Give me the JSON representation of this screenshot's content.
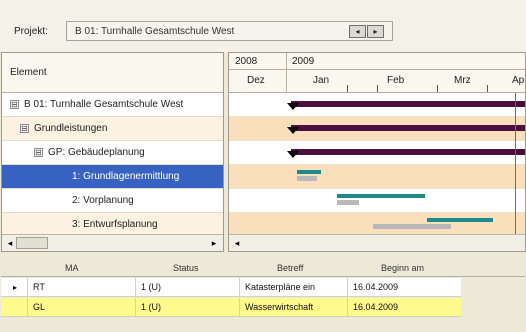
{
  "project": {
    "label": "Projekt:",
    "value": "B 01: Turnhalle Gesamtschule West",
    "btn_prev": "◂",
    "btn_next": "▸"
  },
  "tree": {
    "header": "Element",
    "items": [
      {
        "label": "B 01: Turnhalle Gesamtschule West",
        "exp": "⊟"
      },
      {
        "label": "Grundleistungen",
        "exp": "⊟"
      },
      {
        "label": "GP: Gebäudeplanung",
        "exp": "⊟"
      },
      {
        "label": "1: Grundlagenermittlung",
        "exp": ""
      },
      {
        "label": "2: Vorplanung",
        "exp": ""
      },
      {
        "label": "3: Entwurfsplanung",
        "exp": ""
      }
    ],
    "scroll_left": "◂",
    "scroll_right": "▸"
  },
  "gantt": {
    "years": [
      "2008",
      "2009"
    ],
    "months": [
      "Dez",
      "Jan",
      "Feb",
      "Mrz",
      "Apr"
    ],
    "scroll_left": "◂",
    "colors": {
      "summary": "#4a0f3c",
      "task": "#1f8a8a",
      "baseline": "#b8b8b8",
      "today": "#d24a2a",
      "row_alt": "#f9dfbc"
    }
  },
  "table": {
    "headers": [
      "MA",
      "Status",
      "Betreff",
      "Beginn am"
    ],
    "pointer": "▸",
    "rows": [
      {
        "ma": "RT",
        "status": "1 (U)",
        "betreff": "Katasterpläne ein",
        "beginn": "16.04.2009"
      },
      {
        "ma": "GL",
        "status": "1 (U)",
        "betreff": "Wasserwirtschaft",
        "beginn": "16.04.2009"
      }
    ]
  }
}
